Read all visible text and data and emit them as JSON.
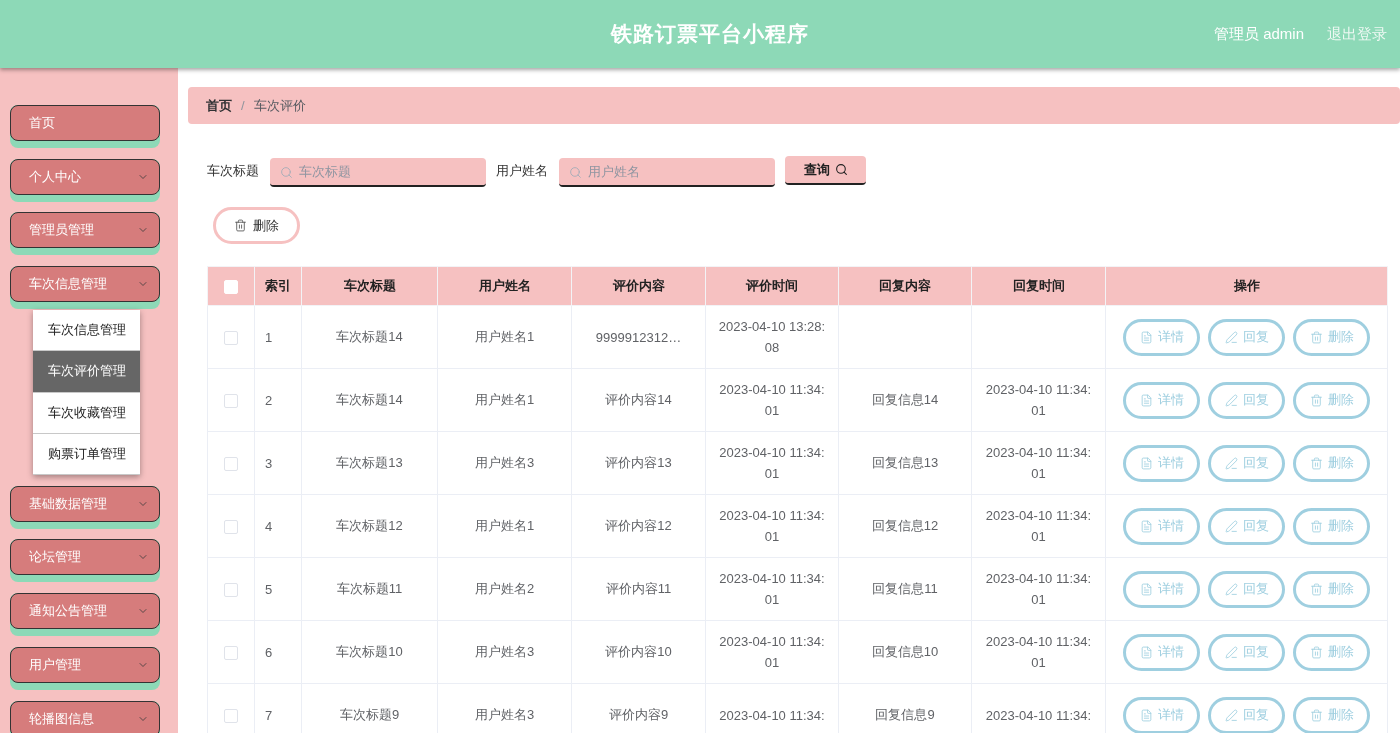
{
  "header": {
    "title": "铁路订票平台小程序",
    "user": "管理员 admin",
    "logout": "退出登录"
  },
  "sidebar": {
    "items": [
      {
        "kind": "link",
        "label": "首页"
      },
      {
        "kind": "group",
        "label": "个人中心",
        "expanded": false
      },
      {
        "kind": "group",
        "label": "管理员管理",
        "expanded": false
      },
      {
        "kind": "group",
        "label": "车次信息管理",
        "expanded": true,
        "children": [
          {
            "label": "车次信息管理",
            "selected": false
          },
          {
            "label": "车次评价管理",
            "selected": true
          },
          {
            "label": "车次收藏管理",
            "selected": false
          },
          {
            "label": "购票订单管理",
            "selected": false
          }
        ]
      },
      {
        "kind": "group",
        "label": "基础数据管理",
        "expanded": false
      },
      {
        "kind": "group",
        "label": "论坛管理",
        "expanded": false
      },
      {
        "kind": "group",
        "label": "通知公告管理",
        "expanded": false
      },
      {
        "kind": "group",
        "label": "用户管理",
        "expanded": false
      },
      {
        "kind": "group",
        "label": "轮播图信息",
        "expanded": false
      }
    ]
  },
  "breadcrumb": {
    "items": [
      "首页",
      "车次评价"
    ],
    "separator": "/"
  },
  "search": {
    "fields": [
      {
        "label": "车次标题",
        "placeholder": "车次标题"
      },
      {
        "label": "用户姓名",
        "placeholder": "用户姓名"
      }
    ],
    "button": "查询"
  },
  "toolbar": {
    "delete_button": "删除"
  },
  "table": {
    "header_checkbox": {
      "checked": false
    },
    "columns": [
      "索引",
      "车次标题",
      "用户姓名",
      "评价内容",
      "评价时间",
      "回复内容",
      "回复时间",
      "操作"
    ],
    "rows": [
      {
        "checked": false,
        "index": "1",
        "title": "车次标题14",
        "user": "用户姓名1",
        "content": "9999912312…",
        "time": "2023-04-10 13:28:08",
        "actions": [
          {
            "kind": "detail",
            "label": "详情"
          },
          {
            "kind": "reply",
            "label": "回复"
          },
          {
            "kind": "delete",
            "label": "删除"
          }
        ]
      },
      {
        "checked": false,
        "index": "2",
        "title": "车次标题14",
        "user": "用户姓名1",
        "content": "评价内容14",
        "time": "2023-04-10 11:34:01",
        "reply_content": "回复信息14",
        "reply_time": "2023-04-10 11:34:01",
        "actions": [
          {
            "kind": "detail",
            "label": "详情"
          },
          {
            "kind": "reply",
            "label": "回复"
          },
          {
            "kind": "delete",
            "label": "删除"
          }
        ]
      },
      {
        "checked": false,
        "index": "3",
        "title": "车次标题13",
        "user": "用户姓名3",
        "content": "评价内容13",
        "time": "2023-04-10 11:34:01",
        "reply_content": "回复信息13",
        "reply_time": "2023-04-10 11:34:01",
        "actions": [
          {
            "kind": "detail",
            "label": "详情"
          },
          {
            "kind": "reply",
            "label": "回复"
          },
          {
            "kind": "delete",
            "label": "删除"
          }
        ]
      },
      {
        "checked": false,
        "index": "4",
        "title": "车次标题12",
        "user": "用户姓名1",
        "content": "评价内容12",
        "time": "2023-04-10 11:34:01",
        "reply_content": "回复信息12",
        "reply_time": "2023-04-10 11:34:01",
        "actions": [
          {
            "kind": "detail",
            "label": "详情"
          },
          {
            "kind": "reply",
            "label": "回复"
          },
          {
            "kind": "delete",
            "label": "删除"
          }
        ]
      },
      {
        "checked": false,
        "index": "5",
        "title": "车次标题11",
        "user": "用户姓名2",
        "content": "评价内容11",
        "time": "2023-04-10 11:34:01",
        "reply_content": "回复信息11",
        "reply_time": "2023-04-10 11:34:01",
        "actions": [
          {
            "kind": "detail",
            "label": "详情"
          },
          {
            "kind": "reply",
            "label": "回复"
          },
          {
            "kind": "delete",
            "label": "删除"
          }
        ]
      },
      {
        "checked": false,
        "index": "6",
        "title": "车次标题10",
        "user": "用户姓名3",
        "content": "评价内容10",
        "time": "2023-04-10 11:34:01",
        "reply_content": "回复信息10",
        "reply_time": "2023-04-10 11:34:01",
        "actions": [
          {
            "kind": "detail",
            "label": "详情"
          },
          {
            "kind": "reply",
            "label": "回复"
          },
          {
            "kind": "delete",
            "label": "删除"
          }
        ]
      },
      {
        "checked": false,
        "index": "7",
        "title": "车次标题9",
        "user": "用户姓名3",
        "content": "评价内容9",
        "time": "2023-04-10 11:34:",
        "reply_content": "回复信息9",
        "reply_time": "2023-04-10 11:34:",
        "actions": [
          {
            "kind": "detail",
            "label": "详情"
          },
          {
            "kind": "reply",
            "label": "回复"
          },
          {
            "kind": "delete",
            "label": "删除"
          }
        ]
      }
    ]
  }
}
